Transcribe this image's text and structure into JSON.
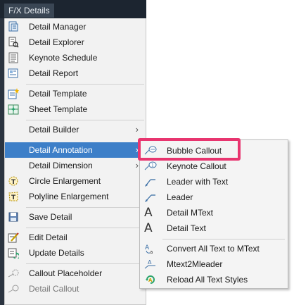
{
  "menubar": {
    "title": "F/X Details"
  },
  "main_menu": [
    {
      "label": "Detail Manager",
      "icon": "detail-manager-icon"
    },
    {
      "label": "Detail Explorer",
      "icon": "detail-explorer-icon"
    },
    {
      "label": "Keynote Schedule",
      "icon": "keynote-schedule-icon"
    },
    {
      "label": "Detail Report",
      "icon": "detail-report-icon"
    },
    {
      "label": "Detail Template",
      "icon": "detail-template-icon"
    },
    {
      "label": "Sheet Template",
      "icon": "sheet-template-icon"
    },
    {
      "label": "Detail Builder",
      "submenu": true
    },
    {
      "label": "Detail Annotation",
      "submenu": true,
      "active": true
    },
    {
      "label": "Detail Dimension",
      "submenu": true
    },
    {
      "label": "Circle Enlargement",
      "icon": "circle-enlargement-icon"
    },
    {
      "label": "Polyline Enlargement",
      "icon": "polyline-enlargement-icon"
    },
    {
      "label": "Save Detail",
      "icon": "save-detail-icon"
    },
    {
      "label": "Edit Detail",
      "icon": "edit-detail-icon"
    },
    {
      "label": "Update Details",
      "icon": "update-details-icon"
    },
    {
      "label": "Callout Placeholder",
      "icon": "callout-placeholder-icon"
    },
    {
      "label": "Detail Callout",
      "icon": "detail-callout-icon"
    }
  ],
  "submenu": [
    {
      "label": "Bubble Callout",
      "icon": "bubble-callout-icon"
    },
    {
      "label": "Keynote Callout",
      "icon": "keynote-callout-icon"
    },
    {
      "label": "Leader with Text",
      "icon": "leader-with-text-icon"
    },
    {
      "label": "Leader",
      "icon": "leader-icon"
    },
    {
      "label": "Detail MText",
      "icon": "detail-mtext-icon",
      "glyph": "A"
    },
    {
      "label": "Detail Text",
      "icon": "detail-text-icon",
      "glyph": "A"
    },
    {
      "label": "Convert All Text to MText",
      "icon": "convert-text-icon"
    },
    {
      "label": "Mtext2Mleader",
      "icon": "mtext2mleader-icon"
    },
    {
      "label": "Reload All Text Styles",
      "icon": "reload-text-styles-icon"
    }
  ],
  "arrow_glyph": "›",
  "colors": {
    "active_bg": "#3d7fc8",
    "highlight_border": "#e8356f",
    "menubar_bg": "#1c2530"
  }
}
